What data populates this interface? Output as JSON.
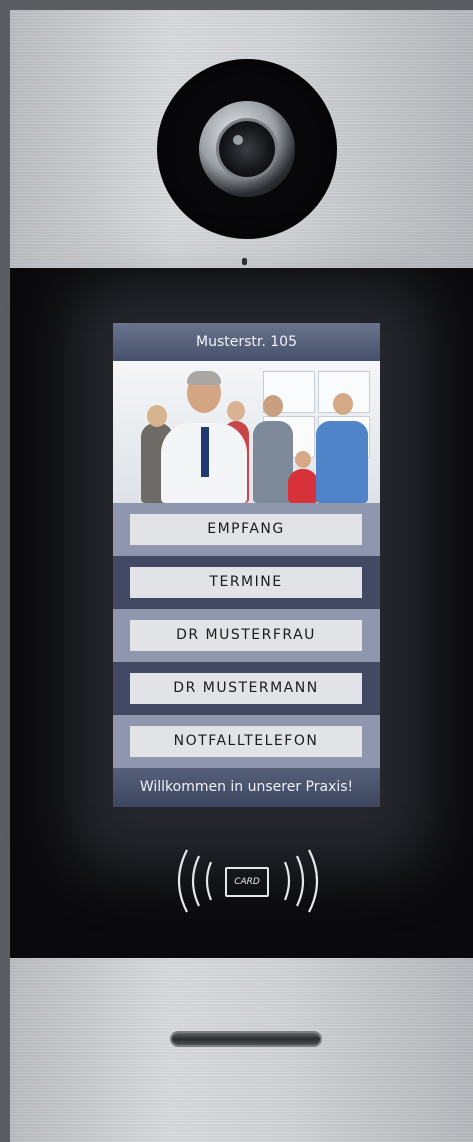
{
  "screen": {
    "address": "Musterstr. 105",
    "buttons": [
      {
        "label": "EMPFANG"
      },
      {
        "label": "TERMINE"
      },
      {
        "label": "DR MUSTERFRAU"
      },
      {
        "label": "DR MUSTERMANN"
      },
      {
        "label": "NOTFALLTELEFON"
      }
    ],
    "footer": "Willkommen in unserer Praxis!"
  },
  "rfid": {
    "card_label": "CARD"
  },
  "colors": {
    "header": "#46506a",
    "row_light": "#8e97ad",
    "row_dark": "#424a63",
    "button": "#e2e3e6"
  }
}
